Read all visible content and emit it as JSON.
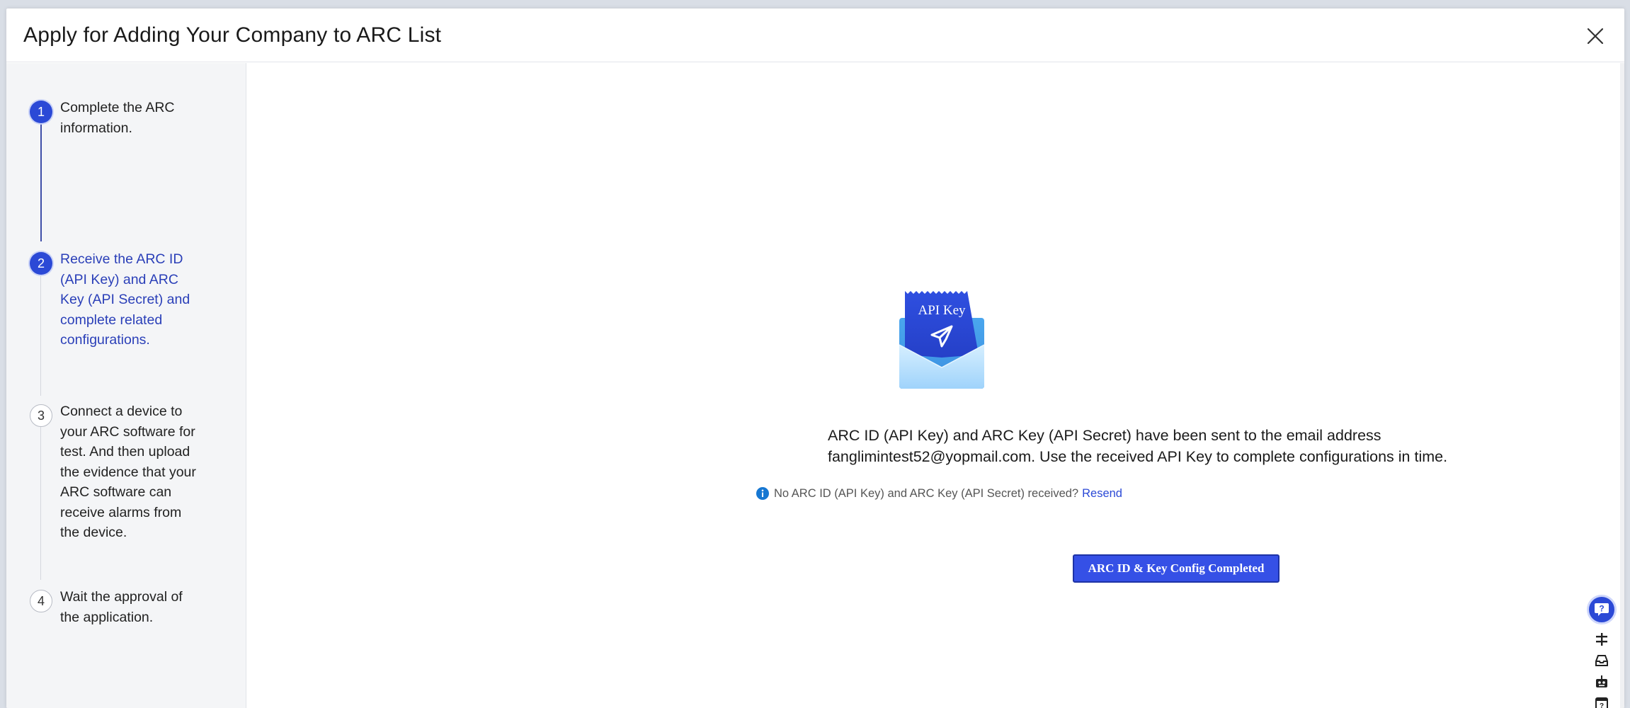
{
  "modal": {
    "title": "Apply for Adding Your Company to ARC List"
  },
  "steps": [
    {
      "number": "1",
      "text": "Complete the ARC information.",
      "state": "done"
    },
    {
      "number": "2",
      "text": "Receive the ARC ID (API Key) and ARC Key (API Secret) and complete related configurations.",
      "state": "current"
    },
    {
      "number": "3",
      "text": "Connect a device to your ARC software for test. And then upload the evidence that your ARC software can receive alarms from the device.",
      "state": "pending"
    },
    {
      "number": "4",
      "text": "Wait the approval of the application.",
      "state": "pending"
    }
  ],
  "main": {
    "illustration_label": "API Key",
    "sent_message": "ARC ID (API Key) and ARC Key (API Secret) have been sent to the email address fanglimintest52@yopmail.com. Use the received API Key to complete configurations in time.",
    "not_received_text": "No ARC ID (API Key) and ARC Key (API Secret) received?",
    "resend_label": "Resend",
    "complete_button_label": "ARC ID & Key Config Completed"
  },
  "colors": {
    "accent": "#2b49d6",
    "current_step_text": "#2a3fb8",
    "button_bg": "#3550e6",
    "info_icon": "#1677d2"
  },
  "tools": {
    "help_icon": "help-icon",
    "icons": [
      "toggle-icon",
      "inbox-icon",
      "robot-icon",
      "calendar-help-icon"
    ]
  }
}
